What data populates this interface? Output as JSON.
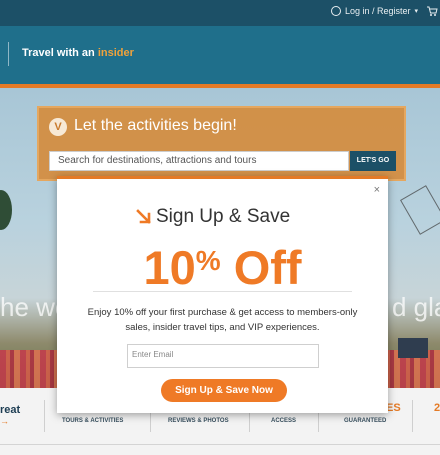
{
  "topbar": {
    "login_label": "Log in / Register",
    "caret": "▾",
    "cart_icon": "cart-icon"
  },
  "header": {
    "tagline_prefix": "Travel with an",
    "tagline_accent": "insider"
  },
  "hero": {
    "search_headline": "Let the activities begin!",
    "search_placeholder": "Search for destinations, attractions and tours",
    "search_button": "LET'S GO",
    "text_left": "he wo",
    "text_right": "d glas"
  },
  "bottom_strip": {
    "partial_left": "reat",
    "arrow": "→",
    "items": [
      "TOURS & ACTIVITIES",
      "REVIEWS & PHOTOS",
      "ACCESS",
      "GUARANTEED"
    ],
    "partial_orange_1": "ES",
    "partial_orange_2": "2"
  },
  "modal": {
    "close": "×",
    "title": "Sign Up & Save",
    "offer_number": "10",
    "offer_percent": "%",
    "offer_word": "Off",
    "description": "Enjoy 10% off your first purchase & get access to members-only sales, insider travel tips, and VIP experiences.",
    "email_placeholder": "Enter Email",
    "button_label": "Sign Up & Save Now"
  },
  "colors": {
    "accent": "#ef7a26",
    "topbar": "#1c5067",
    "header": "#1f6f8b"
  }
}
